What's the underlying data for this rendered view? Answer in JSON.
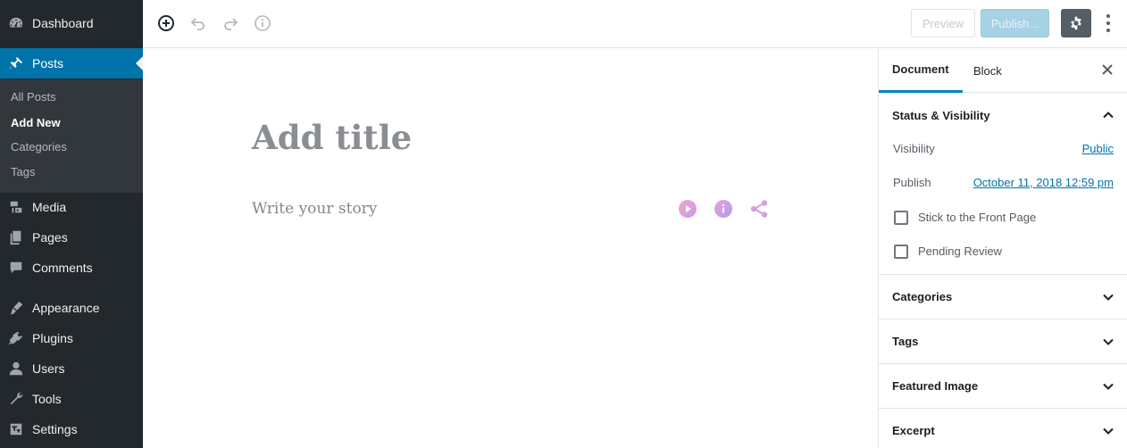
{
  "sidebar": {
    "items": [
      {
        "label": "Dashboard",
        "icon": "dashboard-icon"
      },
      {
        "label": "Posts",
        "icon": "pin-icon"
      },
      {
        "label": "Media",
        "icon": "media-icon"
      },
      {
        "label": "Pages",
        "icon": "pages-icon"
      },
      {
        "label": "Comments",
        "icon": "comments-icon"
      },
      {
        "label": "Appearance",
        "icon": "appearance-icon"
      },
      {
        "label": "Plugins",
        "icon": "plugins-icon"
      },
      {
        "label": "Users",
        "icon": "users-icon"
      },
      {
        "label": "Tools",
        "icon": "tools-icon"
      },
      {
        "label": "Settings",
        "icon": "settings-icon"
      }
    ],
    "submenu": [
      "All Posts",
      "Add New",
      "Categories",
      "Tags"
    ],
    "active_item": "Posts",
    "current_subitem": "Add New"
  },
  "toolbar": {
    "preview_label": "Preview",
    "publish_label": "Publish...",
    "icons": [
      "add-block-icon",
      "undo-icon",
      "redo-icon",
      "info-icon",
      "gear-icon",
      "more-vertical-icon"
    ]
  },
  "editor": {
    "title_placeholder": "Add title",
    "body_placeholder": "Write your story"
  },
  "panel": {
    "tabs": [
      "Document",
      "Block"
    ],
    "active_tab": "Document",
    "status": {
      "heading": "Status & Visibility",
      "visibility_label": "Visibility",
      "visibility_value": "Public",
      "publish_label": "Publish",
      "publish_value": "October 11, 2018 12:59 pm",
      "stick_label": "Stick to the Front Page",
      "pending_label": "Pending Review"
    },
    "sections": [
      "Categories",
      "Tags",
      "Featured Image",
      "Excerpt"
    ]
  },
  "colors": {
    "sidebar_bg": "#23282d",
    "active_bg": "#0073aa",
    "link": "#0073aa",
    "publish_bg": "#a7d1e4"
  }
}
